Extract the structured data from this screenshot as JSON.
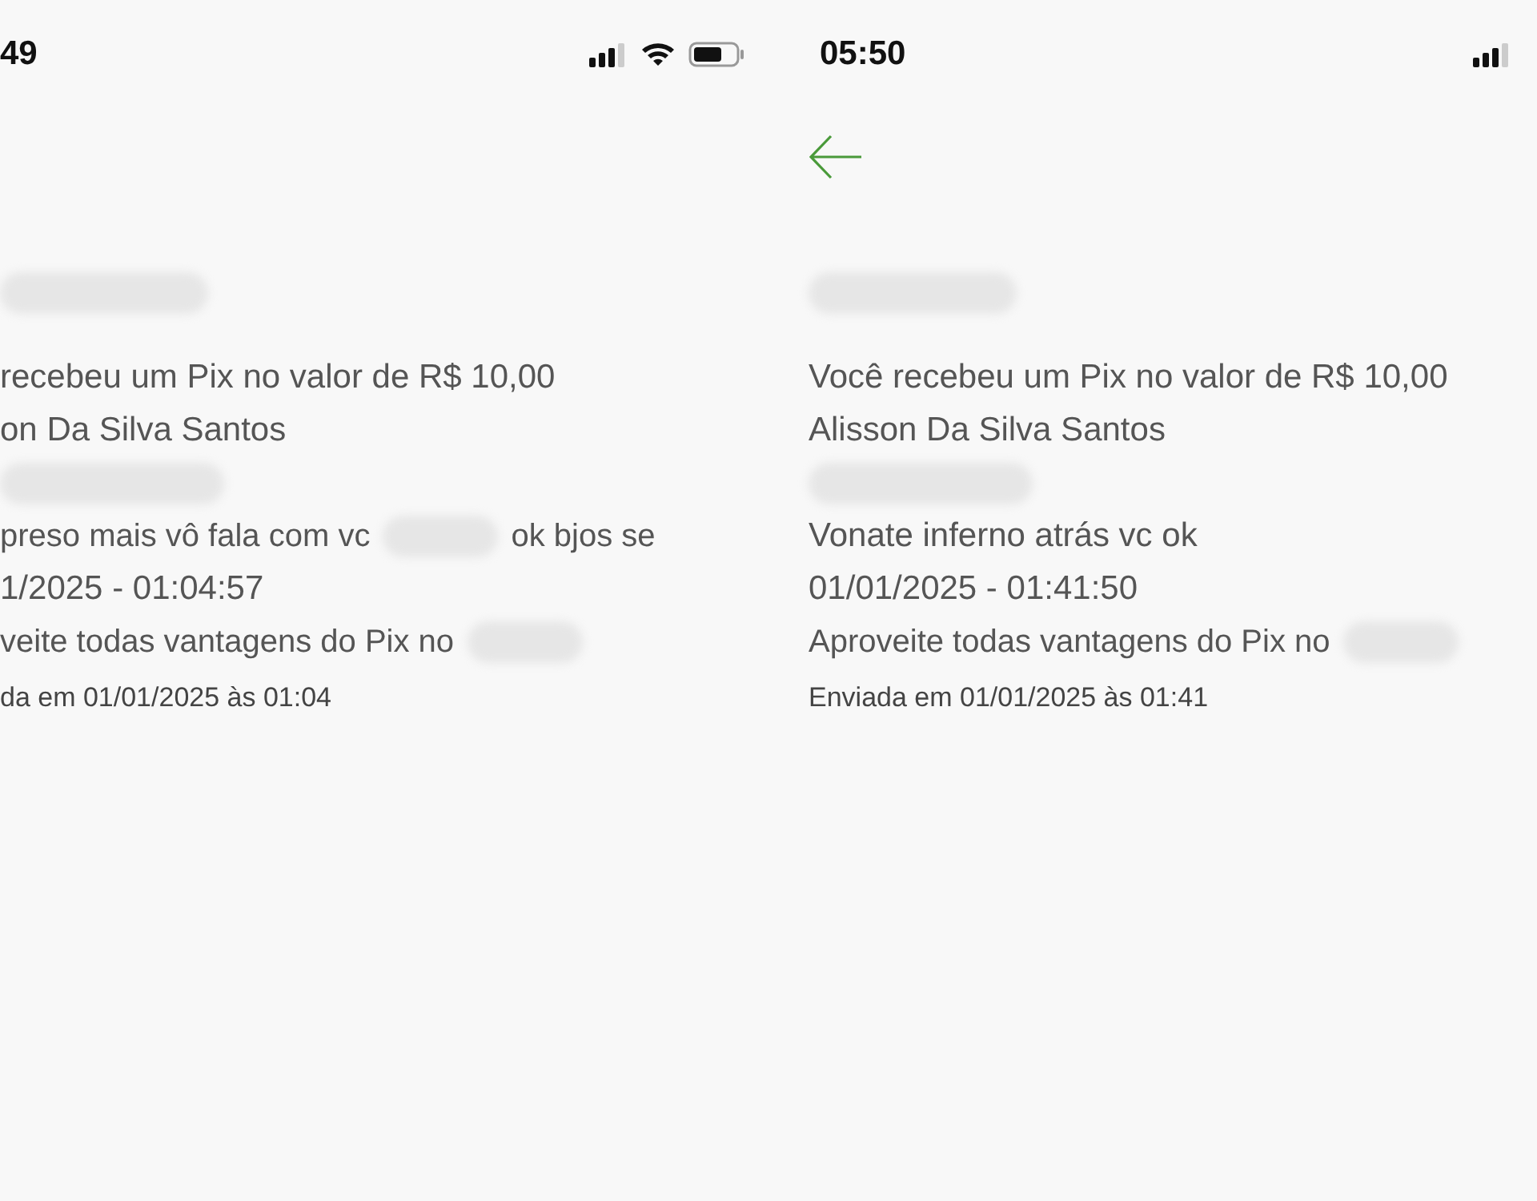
{
  "screens": [
    {
      "time": "49",
      "status_icons": [
        {
          "kind": "signal"
        },
        {
          "kind": "wifi"
        },
        {
          "kind": "battery"
        }
      ],
      "lines": [
        {
          "kind": "redacted"
        },
        {
          "kind": "text",
          "text": "recebeu um Pix no valor de R$ 10,00"
        },
        {
          "kind": "text",
          "text": "on Da Silva Santos"
        },
        {
          "kind": "redacted"
        },
        {
          "kind": "mixed",
          "parts": [
            {
              "kind": "text",
              "text": "preso mais vô fala com vc"
            },
            {
              "kind": "redacted"
            },
            {
              "kind": "text",
              "text": "ok bjos se"
            }
          ]
        },
        {
          "kind": "text",
          "text": "1/2025 - 01:04:57"
        },
        {
          "kind": "mixed",
          "parts": [
            {
              "kind": "text",
              "text": "veite todas vantagens do Pix no"
            },
            {
              "kind": "redacted"
            }
          ]
        },
        {
          "kind": "sent",
          "text": "da em 01/01/2025 às 01:04"
        }
      ]
    },
    {
      "time": "05:50",
      "status_icons": [
        {
          "kind": "signal"
        }
      ],
      "nav": [
        {
          "kind": "back"
        }
      ],
      "lines": [
        {
          "kind": "redacted"
        },
        {
          "kind": "text",
          "text": "Você recebeu um Pix no valor de R$ 10,00"
        },
        {
          "kind": "text",
          "text": "Alisson Da Silva Santos"
        },
        {
          "kind": "redacted"
        },
        {
          "kind": "text",
          "text": "Vonate inferno atrás vc ok"
        },
        {
          "kind": "text",
          "text": "01/01/2025 - 01:41:50"
        },
        {
          "kind": "mixed",
          "parts": [
            {
              "kind": "text",
              "text": "Aproveite todas vantagens do Pix no"
            },
            {
              "kind": "redacted"
            }
          ]
        },
        {
          "kind": "sent",
          "text": "Enviada em 01/01/2025 às 01:41"
        }
      ]
    }
  ]
}
